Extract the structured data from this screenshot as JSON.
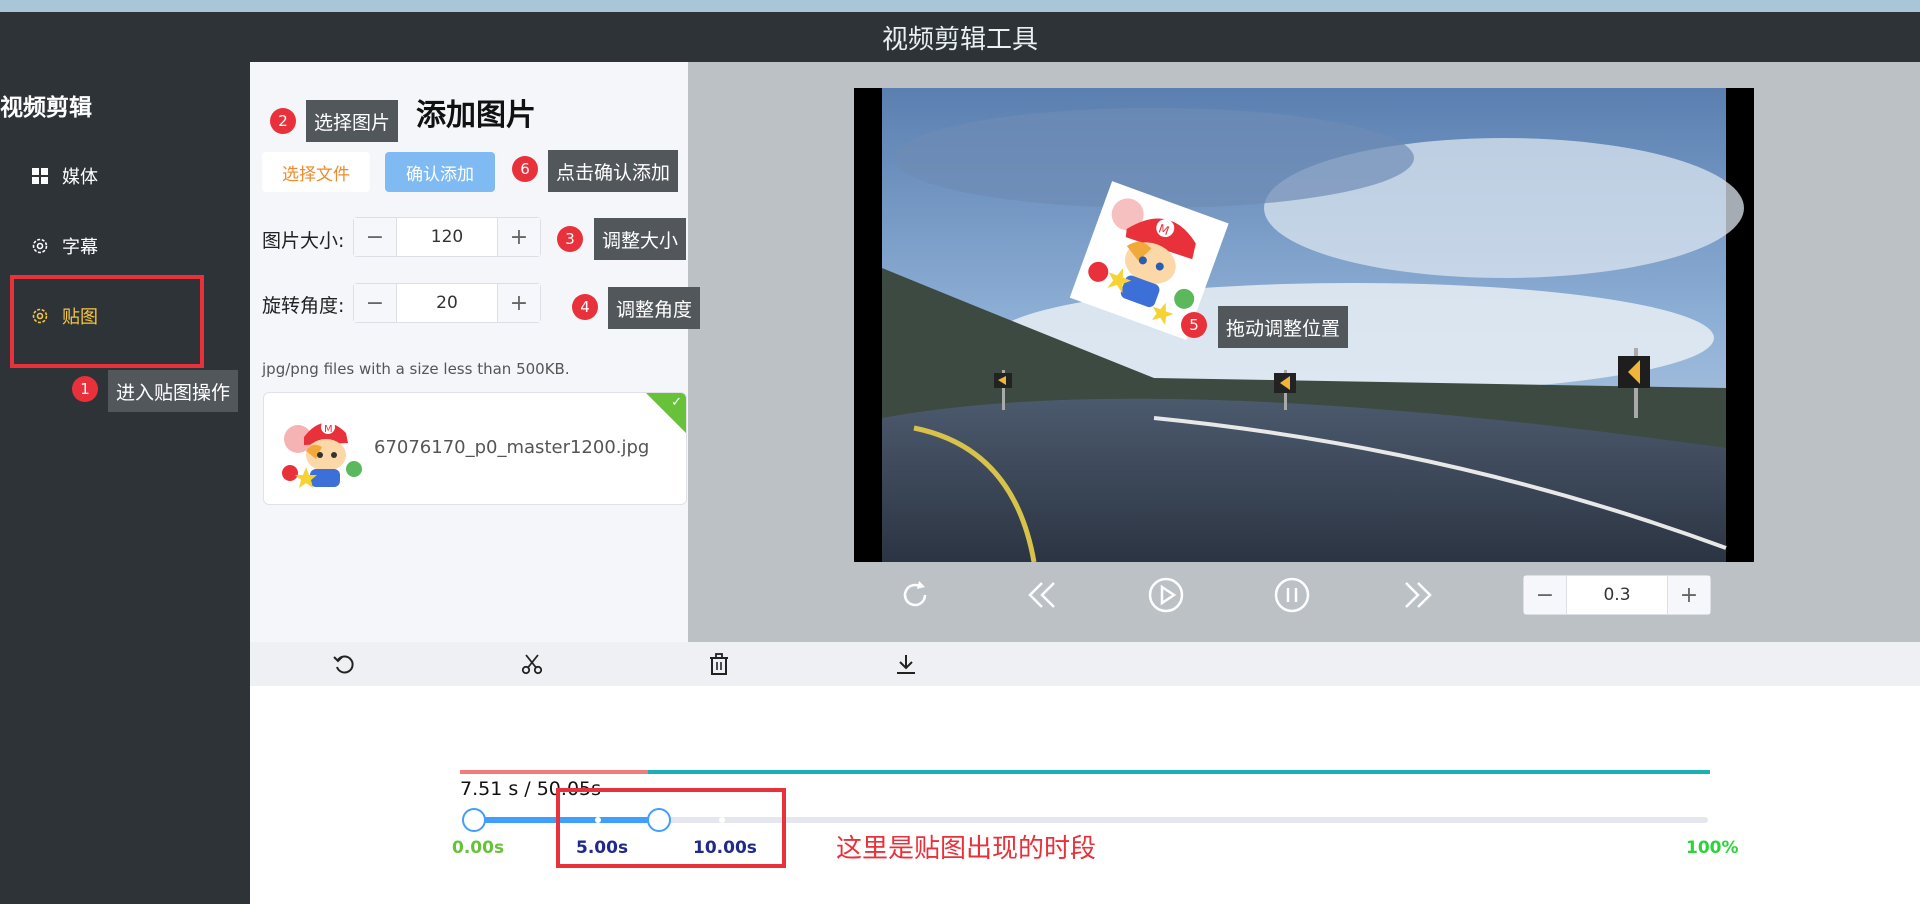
{
  "app": {
    "title": "视频剪辑工具"
  },
  "sidebar": {
    "brand": "视频剪辑",
    "items": [
      {
        "label": "媒体",
        "icon": "grid-icon",
        "active": false
      },
      {
        "label": "字幕",
        "icon": "gear-icon",
        "active": false
      },
      {
        "label": "贴图",
        "icon": "gear-icon",
        "active": true
      }
    ]
  },
  "panel": {
    "title": "添加图片",
    "select_file_label": "选择文件",
    "confirm_label": "确认添加",
    "size_label": "图片大小:",
    "size_value": "120",
    "rotation_label": "旋转角度:",
    "rotation_value": "20",
    "hint": "jpg/png files with a size less than 500KB.",
    "file_name": "67076170_p0_master1200.jpg"
  },
  "player": {
    "speed_value": "0.3",
    "controls": [
      "refresh-icon",
      "rewind-icon",
      "play-icon",
      "pause-icon",
      "forward-icon"
    ]
  },
  "toolbar": {
    "tools": [
      "undo-icon",
      "scissors-icon",
      "trash-icon",
      "download-icon"
    ]
  },
  "timeline": {
    "time_text": "7.51 s / 50.05s",
    "start_label": "0.00s",
    "range_start_label": "5.00s",
    "range_end_label": "10.00s",
    "end_label": "100%",
    "progress_fraction": 0.15
  },
  "annotations": {
    "n1": "1",
    "t1": "进入贴图操作",
    "n2": "2",
    "t2": "选择图片",
    "n3": "3",
    "t3": "调整大小",
    "n4": "4",
    "t4": "调整角度",
    "n5": "5",
    "t5": "拖动调整位置",
    "n6": "6",
    "t6": "点击确认添加",
    "note": "这里是贴图出现的时段"
  },
  "colors": {
    "accent": "#409eff",
    "active_nav": "#f6c544",
    "annotation_red": "#e8313a",
    "teal": "#1ab0b8"
  }
}
